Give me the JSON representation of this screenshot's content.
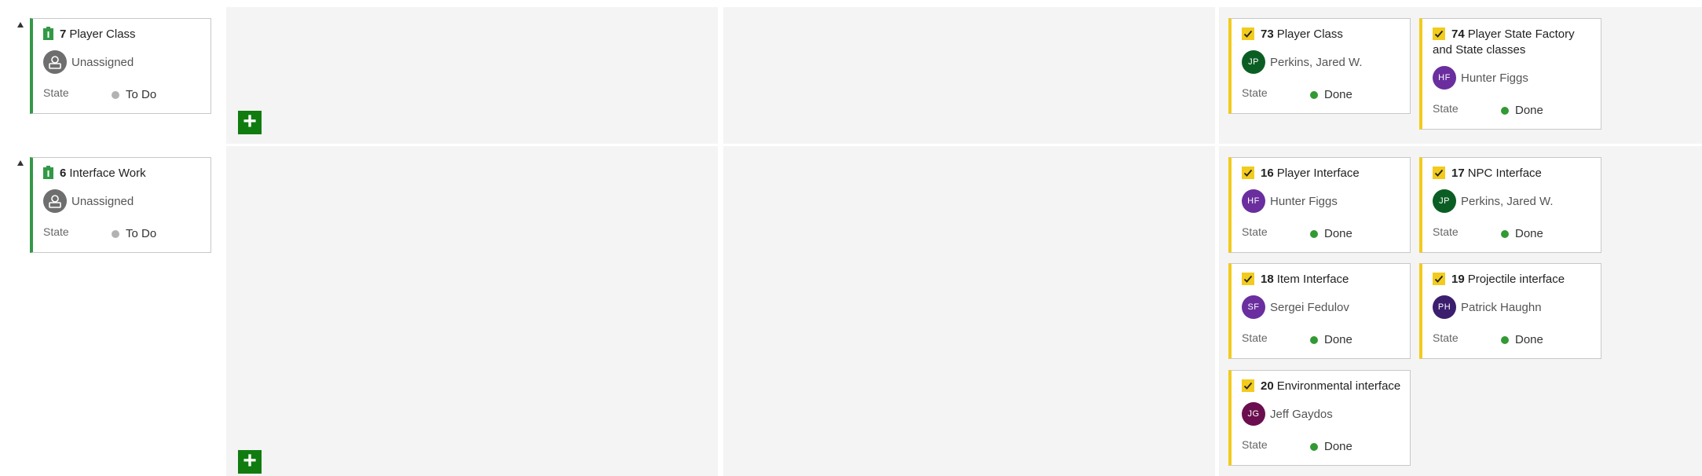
{
  "colors": {
    "pbi_bar": "#339947",
    "task_bar": "#f2cb1d",
    "todo_dot": "#b2b2b2",
    "done_dot": "#339933",
    "add_button": "#107c10"
  },
  "state_label": "State",
  "add_label": "+",
  "rows": [
    {
      "parent": {
        "id": "7",
        "title": "Player Class",
        "assignee": "Unassigned",
        "state": "To Do"
      },
      "tasks": [
        {
          "id": "73",
          "title": "Player Class",
          "initials": "JP",
          "assignee": "Perkins, Jared W.",
          "avatar_color": "#0b5e23",
          "state": "Done"
        },
        {
          "id": "74",
          "title": "Player State Factory and State classes",
          "initials": "HF",
          "assignee": "Hunter Figgs",
          "avatar_color": "#6a2e9f",
          "state": "Done"
        }
      ]
    },
    {
      "parent": {
        "id": "6",
        "title": "Interface Work",
        "assignee": "Unassigned",
        "state": "To Do"
      },
      "tasks": [
        {
          "id": "16",
          "title": "Player Interface",
          "initials": "HF",
          "assignee": "Hunter Figgs",
          "avatar_color": "#6a2e9f",
          "state": "Done"
        },
        {
          "id": "17",
          "title": "NPC Interface",
          "initials": "JP",
          "assignee": "Perkins, Jared W.",
          "avatar_color": "#0b5e23",
          "state": "Done"
        },
        {
          "id": "18",
          "title": "Item Interface",
          "initials": "SF",
          "assignee": "Sergei Fedulov",
          "avatar_color": "#6a2e9f",
          "state": "Done"
        },
        {
          "id": "19",
          "title": "Projectile interface",
          "initials": "PH",
          "assignee": "Patrick Haughn",
          "avatar_color": "#3b1e6e",
          "state": "Done"
        },
        {
          "id": "20",
          "title": "Environmental interface",
          "initials": "JG",
          "assignee": "Jeff Gaydos",
          "avatar_color": "#6b0e4f",
          "state": "Done"
        }
      ]
    }
  ]
}
